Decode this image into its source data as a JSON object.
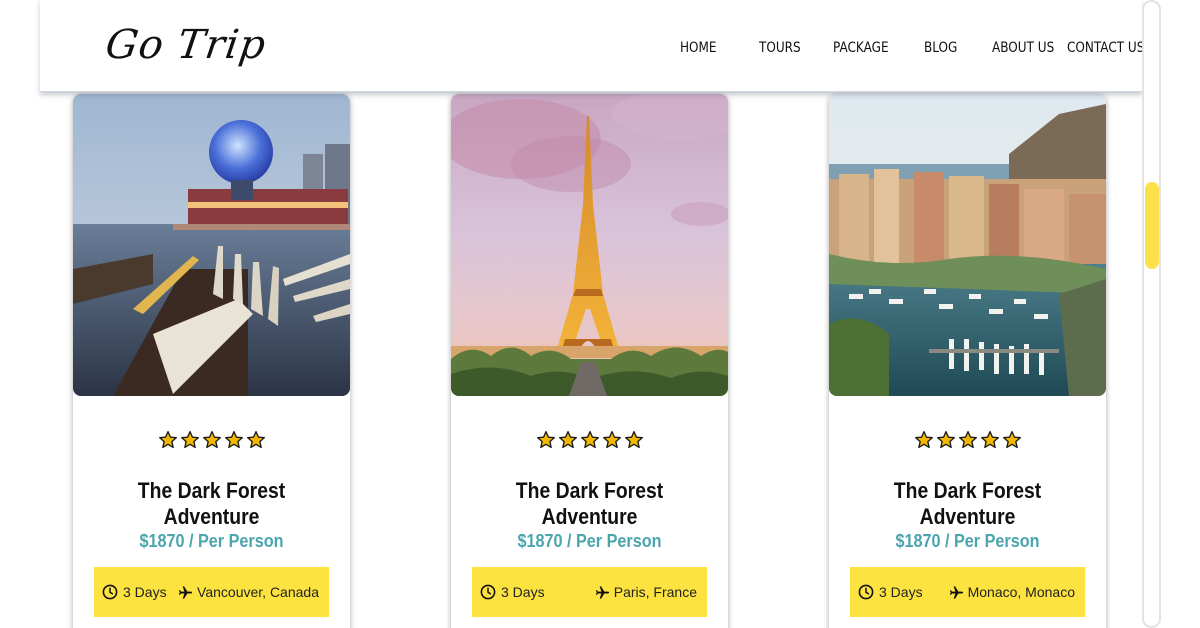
{
  "header": {
    "logo": "Go Trip",
    "nav": [
      "HOME",
      "TOURS",
      "PACKAGE",
      "BLOG",
      "ABOUT US",
      "CONTACT US"
    ]
  },
  "colors": {
    "accent_yellow": "#fde33f",
    "price_teal": "#4aa5ad",
    "star_fill": "#f5b800"
  },
  "cards": [
    {
      "image": "vancouver-science-world-harbor",
      "rating": 5,
      "title": "The Dark Forest Adventure",
      "price": "$1870 / Per Person",
      "duration": "3 Days",
      "location": "Vancouver, Canada"
    },
    {
      "image": "paris-eiffel-tower",
      "rating": 5,
      "title": "The Dark Forest Adventure",
      "price": "$1870 / Per Person",
      "duration": "3 Days",
      "location": "Paris, France"
    },
    {
      "image": "monaco-harbor",
      "rating": 5,
      "title": "The Dark Forest Adventure",
      "price": "$1870 / Per Person",
      "duration": "3 Days",
      "location": "Monaco, Monaco"
    }
  ]
}
